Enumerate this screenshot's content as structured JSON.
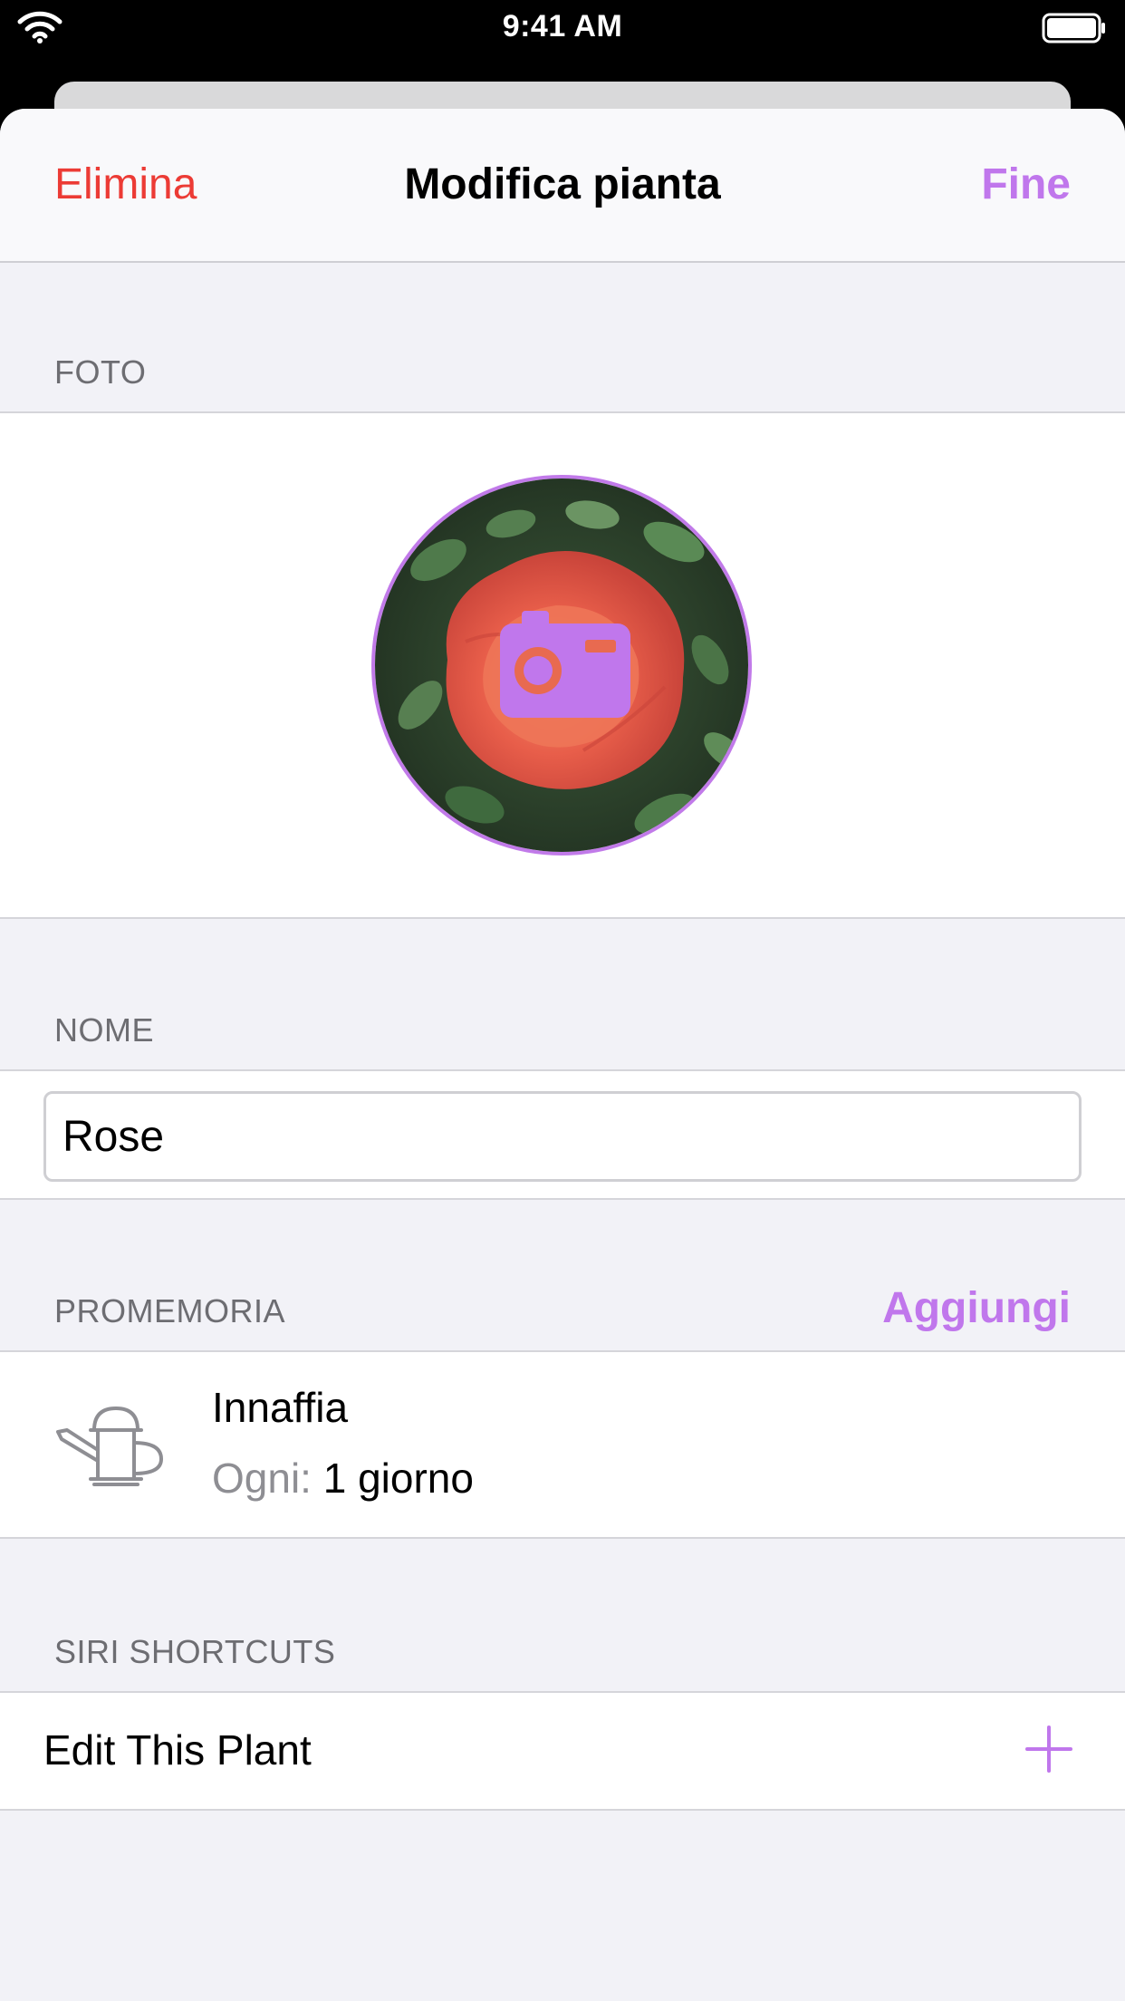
{
  "status_bar": {
    "time": "9:41 AM"
  },
  "nav": {
    "left_label": "Elimina",
    "title": "Modifica pianta",
    "right_label": "Fine"
  },
  "sections": {
    "photo_header": "FOTO",
    "name_header": "NOME",
    "reminders_header": "PROMEMORIA",
    "shortcuts_header": "SIRI SHORTCUTS"
  },
  "name_field": {
    "value": "Rose"
  },
  "reminders": {
    "add_label": "Aggiungi",
    "items": [
      {
        "title": "Innaffia",
        "interval_label": "Ogni:",
        "interval_value": "1 giorno",
        "icon": "watering-can-icon"
      }
    ]
  },
  "shortcuts": {
    "items": [
      {
        "label": "Edit This Plant",
        "icon": "plus-icon"
      }
    ]
  },
  "colors": {
    "accent": "#c077ec",
    "destructive": "#ec3b35",
    "section_text": "#6d6d72",
    "background": "#f2f2f7"
  }
}
